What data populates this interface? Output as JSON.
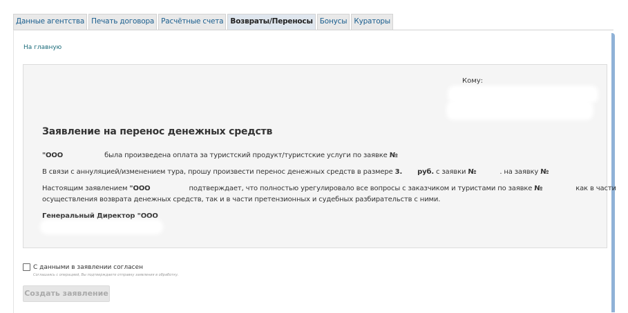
{
  "tabs": [
    {
      "label": "Данные агентства"
    },
    {
      "label": "Печать договора"
    },
    {
      "label": "Расчётные счета"
    },
    {
      "label": "Возвраты/Переносы"
    },
    {
      "label": "Бонусы"
    },
    {
      "label": "Кураторы"
    }
  ],
  "active_tab": "Возвраты/Переносы",
  "home_link": "На главную",
  "doc": {
    "to_label": "Кому:",
    "title": "Заявление на перенос денежных средств",
    "l1_a": "\"ООО",
    "l1_b": "была произведена оплата за туристский продукт/туристские услуги по заявке",
    "l1_c": "№",
    "l2_a": "В связи с аннуляцией/изменением тура, прошу произвести перенос денежных средств в размере",
    "l2_b": "3.",
    "l2_c": "руб.",
    "l2_d": "с заявки",
    "l2_e": "№",
    "l2_f": ". на заявку",
    "l2_g": "№",
    "l3_a": "Настоящим заявлением",
    "l3_b": "\"ООО",
    "l3_c": "подтверждает, что полностью урегулировало все вопросы с заказчиком и туристами по заявке",
    "l3_d": "№",
    "l3_e": "как в части",
    "l4": "осуществления возврата денежных средств, так и в части претензионных и судебных разбирательств с ними.",
    "sign": "Генеральный Директор \"ООО"
  },
  "consent": {
    "label": "С данными в заявлении согласен",
    "hint": "Соглашаясь с операцией, Вы подтверждаете отправку заявления в обработку.",
    "checked": false
  },
  "create_button": "Создать заявление",
  "colors": {
    "accent": "#8fb2d7",
    "link": "#1a5e8e"
  }
}
